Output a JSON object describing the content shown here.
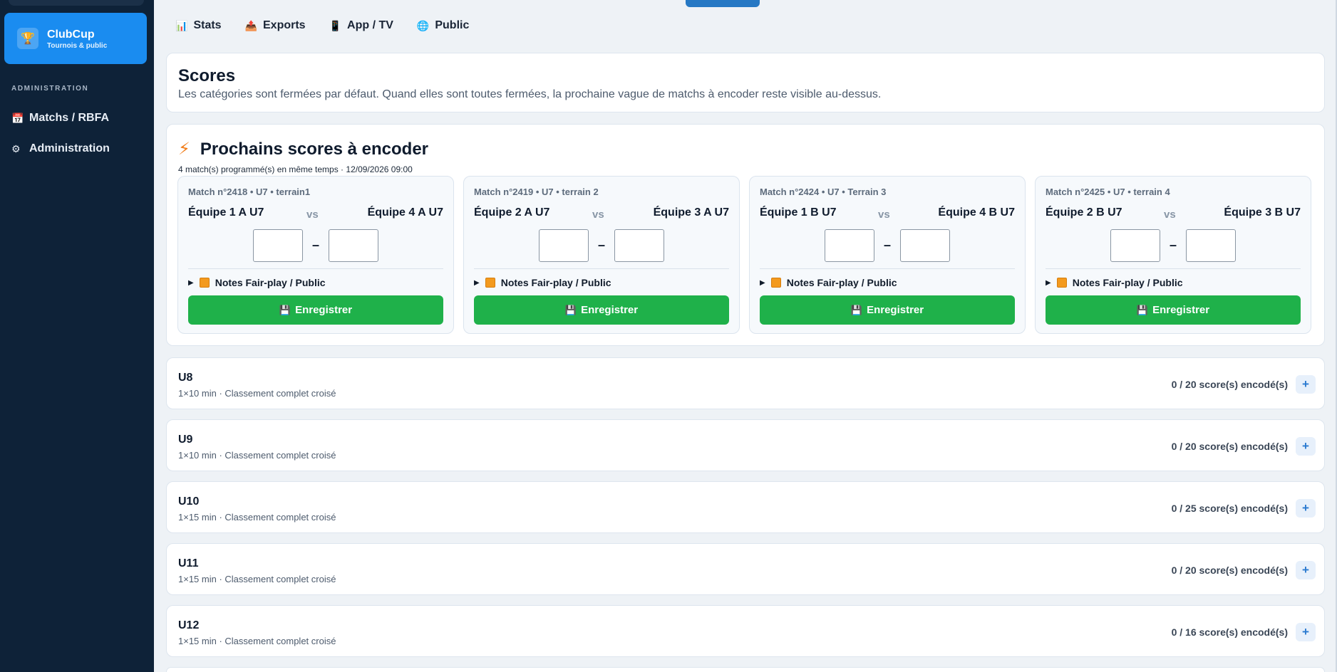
{
  "brand": {
    "logo_icon": "trophy-icon",
    "logo_glyph": "🏆",
    "title": "ClubCup",
    "subtitle": "Tournois & public",
    "color": "#1a8cf0"
  },
  "sidebar": {
    "section": "ADMINISTRATION",
    "items": [
      {
        "label": "Matchs / RBFA",
        "icon": "calendar-icon",
        "glyph": "📅"
      },
      {
        "label": "Administration",
        "icon": "gear-icon",
        "glyph": "⚙"
      }
    ]
  },
  "tabs": [
    {
      "label": "Stats",
      "icon": "bar-chart-icon",
      "glyph": "📊"
    },
    {
      "label": "Exports",
      "icon": "export-icon",
      "glyph": "📤"
    },
    {
      "label": "App / TV",
      "icon": "phone-icon",
      "glyph": "📱"
    },
    {
      "label": "Public",
      "icon": "globe-icon",
      "glyph": "🌐"
    }
  ],
  "scores": {
    "title": "Scores",
    "description": "Les catégories sont fermées par défaut. Quand elles sont toutes fermées, la prochaine vague de matchs à encoder reste visible au-dessus."
  },
  "next": {
    "icon": "lightning-icon",
    "glyph": "⚡",
    "title": "Prochains scores à encoder",
    "meta": "4 match(s) programmé(s) en même temps · 12/09/2026 09:00",
    "vs": "vs",
    "dash": "–",
    "notes_label": "Notes Fair-play / Public",
    "save_label": "Enregistrer",
    "save_glyph": "💾",
    "matches": [
      {
        "head": "Match n°2418 • U7 • terrain1",
        "home": "Équipe 1 A U7",
        "away": "Équipe 4 A U7",
        "home_score": "",
        "away_score": ""
      },
      {
        "head": "Match n°2419 • U7 • terrain 2",
        "home": "Équipe 2 A U7",
        "away": "Équipe 3 A U7",
        "home_score": "",
        "away_score": ""
      },
      {
        "head": "Match n°2424 • U7 • Terrain 3",
        "home": "Équipe 1 B U7",
        "away": "Équipe 4 B U7",
        "home_score": "",
        "away_score": ""
      },
      {
        "head": "Match n°2425 • U7 • terrain 4",
        "home": "Équipe 2 B U7",
        "away": "Équipe 3 B U7",
        "home_score": "",
        "away_score": ""
      }
    ]
  },
  "categories": [
    {
      "name": "U8",
      "meta": "1×10 min · Classement complet croisé",
      "count": "0 / 20 score(s) encodé(s)",
      "toggle": "+"
    },
    {
      "name": "U9",
      "meta": "1×10 min · Classement complet croisé",
      "count": "0 / 20 score(s) encodé(s)",
      "toggle": "+"
    },
    {
      "name": "U10",
      "meta": "1×15 min · Classement complet croisé",
      "count": "0 / 25 score(s) encodé(s)",
      "toggle": "+"
    },
    {
      "name": "U11",
      "meta": "1×15 min · Classement complet croisé",
      "count": "0 / 20 score(s) encodé(s)",
      "toggle": "+"
    },
    {
      "name": "U12",
      "meta": "1×15 min · Classement complet croisé",
      "count": "0 / 16 score(s) encodé(s)",
      "toggle": "+"
    }
  ],
  "colors": {
    "sidebar": "#0e2238",
    "save_button": "#1fb14a",
    "accent": "#2678c4"
  }
}
